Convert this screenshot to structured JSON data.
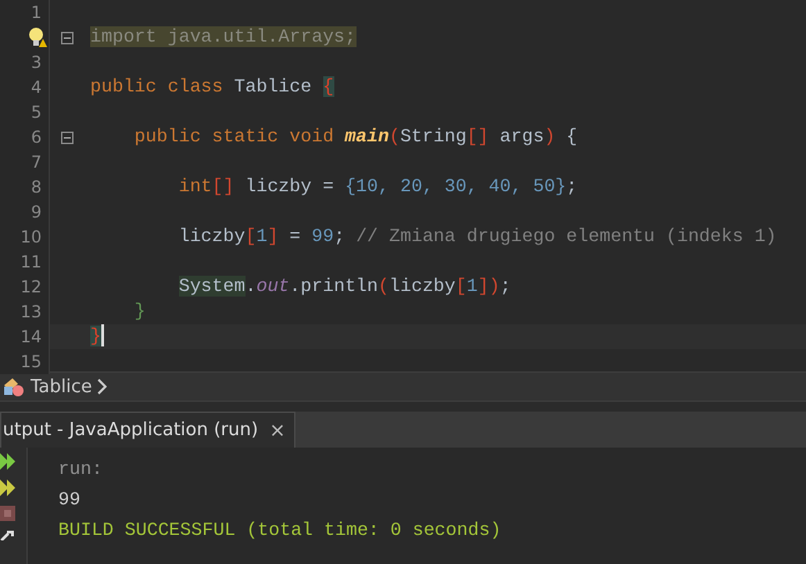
{
  "editor": {
    "lines": [
      {
        "number": "1"
      },
      {
        "hint": true,
        "fold": true,
        "tokens": [
          {
            "text": "import java.util.Arrays;",
            "kind": "unused"
          }
        ]
      },
      {
        "number": "3"
      },
      {
        "number": "4",
        "tokens": [
          {
            "text": "public class ",
            "kind": "keyword"
          },
          {
            "text": "Tablice ",
            "kind": "plain"
          },
          {
            "text": "{",
            "kind": "match"
          }
        ]
      },
      {
        "number": "5"
      },
      {
        "number": "6",
        "fold": true,
        "tokens": [
          {
            "text": "    public static void ",
            "kind": "keyword"
          },
          {
            "text": "main",
            "kind": "method"
          },
          {
            "text": "(",
            "kind": "bracket"
          },
          {
            "text": "String",
            "kind": "plain"
          },
          {
            "text": "[]",
            "kind": "bracket"
          },
          {
            "text": " args",
            "kind": "plain"
          },
          {
            "text": ")",
            "kind": "bracket"
          },
          {
            "text": " {",
            "kind": "plain"
          }
        ]
      },
      {
        "number": "7"
      },
      {
        "number": "8",
        "tokens": [
          {
            "text": "        int",
            "kind": "keyword"
          },
          {
            "text": "[]",
            "kind": "bracket"
          },
          {
            "text": " liczby = ",
            "kind": "plain"
          },
          {
            "text": "{10, 20, 30, 40, 50}",
            "kind": "number"
          },
          {
            "text": ";",
            "kind": "plain"
          }
        ]
      },
      {
        "number": "9"
      },
      {
        "number": "10",
        "tokens": [
          {
            "text": "        liczby",
            "kind": "plain"
          },
          {
            "text": "[",
            "kind": "bracket"
          },
          {
            "text": "1",
            "kind": "number"
          },
          {
            "text": "]",
            "kind": "bracket"
          },
          {
            "text": " = ",
            "kind": "plain"
          },
          {
            "text": "99",
            "kind": "number"
          },
          {
            "text": ";",
            "kind": "plain"
          },
          {
            "text": " // Zmiana drugiego elementu (indeks 1)",
            "kind": "comment"
          }
        ]
      },
      {
        "number": "11"
      },
      {
        "number": "12",
        "tokens": [
          {
            "text": "        System",
            "kind": "class"
          },
          {
            "text": ".",
            "kind": "plain"
          },
          {
            "text": "out",
            "kind": "field"
          },
          {
            "text": ".println",
            "kind": "plain"
          },
          {
            "text": "(",
            "kind": "bracket"
          },
          {
            "text": "liczby",
            "kind": "plain"
          },
          {
            "text": "[",
            "kind": "bracket"
          },
          {
            "text": "1",
            "kind": "number"
          },
          {
            "text": "])",
            "kind": "bracket"
          },
          {
            "text": ";",
            "kind": "plain"
          }
        ]
      },
      {
        "number": "13",
        "tokens": [
          {
            "text": "    }",
            "kind": "scope"
          }
        ]
      },
      {
        "number": "14",
        "current": true,
        "tokens": [
          {
            "text": "}",
            "kind": "match"
          }
        ]
      },
      {
        "number": "15"
      }
    ]
  },
  "breadcrumb": {
    "items": [
      {
        "label": "Tablice"
      }
    ]
  },
  "output": {
    "tab": {
      "title": "utput - JavaApplication (run)",
      "close": "×",
      "selected": true
    },
    "lines": [
      {
        "text": "run:",
        "kind": "info"
      },
      {
        "text": "99",
        "kind": "plain"
      },
      {
        "text": "BUILD SUCCESSFUL (total time: 0 seconds)",
        "kind": "success"
      }
    ]
  }
}
